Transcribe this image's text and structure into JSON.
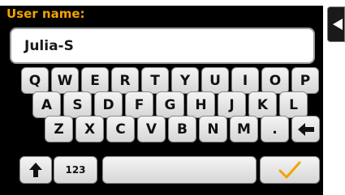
{
  "header": {
    "title": "User name:"
  },
  "input": {
    "value": "Julia-S"
  },
  "keyboard": {
    "rows": [
      [
        "Q",
        "W",
        "E",
        "R",
        "T",
        "Y",
        "U",
        "I",
        "O",
        "P"
      ],
      [
        "A",
        "S",
        "D",
        "F",
        "G",
        "H",
        "J",
        "K",
        "L"
      ],
      [
        "Z",
        "X",
        "C",
        "V",
        "B",
        "N",
        "M",
        "."
      ]
    ],
    "mode_key": "123"
  },
  "colors": {
    "title": "#f2a300",
    "confirm": "#f2a300"
  },
  "icons": {
    "backspace": "left-arrow-icon",
    "shift": "up-arrow-icon",
    "confirm": "checkmark-icon",
    "side": "back-arrow-icon"
  }
}
